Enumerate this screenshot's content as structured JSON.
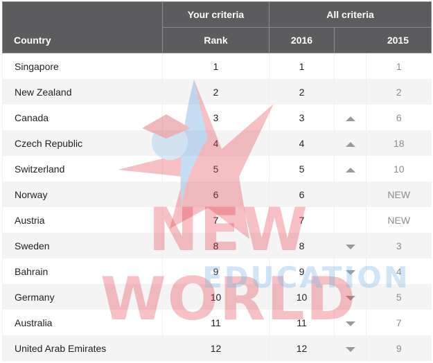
{
  "header": {
    "your_criteria": "Your criteria",
    "all_criteria": "All criteria",
    "country": "Country",
    "rank": "Rank",
    "year_current": "2016",
    "year_prev": "2015"
  },
  "rows": [
    {
      "country": "Singapore",
      "rank": "1",
      "y2016": "1",
      "trend": "none",
      "y2015": "1"
    },
    {
      "country": "New Zealand",
      "rank": "2",
      "y2016": "2",
      "trend": "none",
      "y2015": "2"
    },
    {
      "country": "Canada",
      "rank": "3",
      "y2016": "3",
      "trend": "up",
      "y2015": "6"
    },
    {
      "country": "Czech Republic",
      "rank": "4",
      "y2016": "4",
      "trend": "up",
      "y2015": "18"
    },
    {
      "country": "Switzerland",
      "rank": "5",
      "y2016": "5",
      "trend": "up",
      "y2015": "10"
    },
    {
      "country": "Norway",
      "rank": "6",
      "y2016": "6",
      "trend": "none",
      "y2015": "NEW"
    },
    {
      "country": "Austria",
      "rank": "7",
      "y2016": "7",
      "trend": "none",
      "y2015": "NEW"
    },
    {
      "country": "Sweden",
      "rank": "8",
      "y2016": "8",
      "trend": "down",
      "y2015": "3"
    },
    {
      "country": "Bahrain",
      "rank": "9",
      "y2016": "9",
      "trend": "down",
      "y2015": "4"
    },
    {
      "country": "Germany",
      "rank": "10",
      "y2016": "10",
      "trend": "down",
      "y2015": "5"
    },
    {
      "country": "Australia",
      "rank": "11",
      "y2016": "11",
      "trend": "down",
      "y2015": "7"
    },
    {
      "country": "United Arab Emirates",
      "rank": "12",
      "y2016": "12",
      "trend": "down",
      "y2015": "9"
    }
  ],
  "watermark": {
    "line1": "NEW WORLD",
    "line2": "EDUCATION"
  },
  "colors": {
    "header_bg": "#5c5c5e",
    "trend_arrow": "#9a9a9a",
    "watermark_red": "#e43c46",
    "watermark_blue": "#78b4e6"
  }
}
